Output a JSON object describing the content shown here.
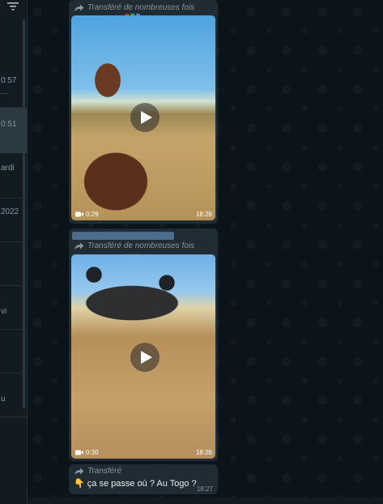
{
  "sidebar": {
    "rows": [
      {
        "time": "0:57",
        "snippet": "..."
      },
      {
        "time": "0:51",
        "snippet": ""
      },
      {
        "time": "ardi",
        "snippet": ""
      },
      {
        "time": "2022",
        "snippet": ""
      },
      {
        "time": "",
        "snippet": ""
      },
      {
        "time": "vi",
        "snippet": ""
      },
      {
        "time": "",
        "snippet": ""
      },
      {
        "time": "u",
        "snippet": ""
      }
    ]
  },
  "messages": [
    {
      "forward_label": "Transféré de nombreuses fois",
      "duration": "0:29",
      "time": "18:26"
    },
    {
      "forward_label": "Transféré de nombreuses fois",
      "duration": "0:30",
      "time": "18:26"
    },
    {
      "forward_label": "Transféré",
      "text": "ça se passe où ? Au Togo ?",
      "emoji": "👇",
      "time": "18:27"
    }
  ],
  "hearts": [
    "♥",
    "♥",
    "♥"
  ],
  "colors": {
    "bubble": "#202c33",
    "background": "#0b141a",
    "sidebar": "#111b21",
    "muted": "#8696a0"
  }
}
